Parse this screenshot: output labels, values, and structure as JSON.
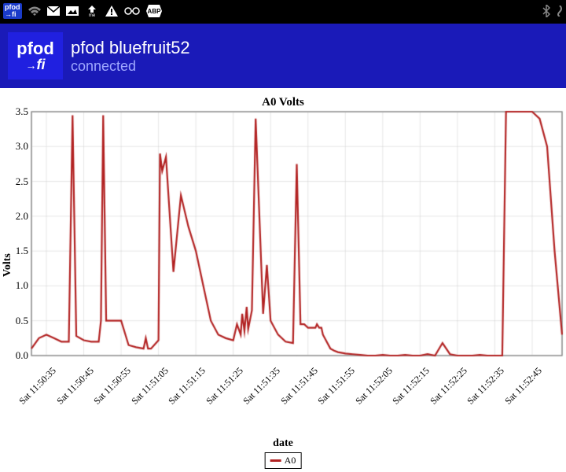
{
  "status_bar": {
    "left_icons": [
      "pfod-mini",
      "wifi-icon",
      "mail-icon",
      "picture-icon",
      "me-icon",
      "alert-icon",
      "glasses-icon",
      "abp-icon"
    ],
    "right_icons": [
      "bluetooth-icon",
      "battery-icon"
    ]
  },
  "header": {
    "logo_l1": "pfod",
    "logo_l2": "fi",
    "title": "pfod bluefruit52",
    "status": "connected"
  },
  "chart_data": {
    "type": "line",
    "title": "A0 Volts",
    "ylabel": "Volts",
    "xlabel": "date",
    "ylim": [
      0.0,
      3.5
    ],
    "ytick": [
      0.0,
      0.5,
      1.0,
      1.5,
      2.0,
      2.5,
      3.0,
      3.5
    ],
    "categories": [
      "Sat 11:50:35",
      "Sat 11:50:45",
      "Sat 11:50:55",
      "Sat 11:51:05",
      "Sat 11:51:15",
      "Sat 11:51:25",
      "Sat 11:51:35",
      "Sat 11:51:45",
      "Sat 11:51:55",
      "Sat 11:52:05",
      "Sat 11:52:15",
      "Sat 11:52:25",
      "Sat 11:52:35",
      "Sat 11:52:45"
    ],
    "legend": [
      "A0"
    ],
    "series": [
      {
        "name": "A0",
        "color": "#b22222",
        "x": [
          0,
          1,
          2,
          3,
          4,
          5,
          5.5,
          6,
          7,
          8,
          9,
          9.3,
          9.6,
          10,
          11,
          12,
          13,
          14,
          15,
          15.3,
          15.6,
          16,
          17,
          17.2,
          17.5,
          18,
          19,
          20,
          21,
          22,
          23,
          24,
          25,
          26,
          27,
          27.5,
          28,
          28.2,
          28.5,
          28.8,
          29,
          29.5,
          30,
          31,
          31.5,
          32,
          33,
          34,
          35,
          35.5,
          36,
          36.5,
          37,
          38,
          38.2,
          38.5,
          38.8,
          39,
          40,
          40.5,
          41,
          42,
          43,
          44,
          45,
          46,
          47,
          48,
          49,
          50,
          51,
          52,
          53,
          54,
          55,
          56,
          57,
          58,
          59,
          60,
          61,
          62,
          63,
          63.5,
          64,
          65,
          66,
          67,
          68,
          69,
          70,
          71
        ],
        "values": [
          0.1,
          0.25,
          0.3,
          0.25,
          0.2,
          0.2,
          3.45,
          0.28,
          0.22,
          0.2,
          0.2,
          0.5,
          3.45,
          0.5,
          0.5,
          0.5,
          0.15,
          0.12,
          0.1,
          0.25,
          0.1,
          0.1,
          0.22,
          2.9,
          2.65,
          2.85,
          1.2,
          2.3,
          1.85,
          1.5,
          1.0,
          0.5,
          0.3,
          0.25,
          0.22,
          0.45,
          0.3,
          0.6,
          0.35,
          0.7,
          0.38,
          0.65,
          3.4,
          0.6,
          1.3,
          0.5,
          0.3,
          0.2,
          0.18,
          2.75,
          0.45,
          0.45,
          0.4,
          0.4,
          0.45,
          0.4,
          0.4,
          0.3,
          0.1,
          0.07,
          0.05,
          0.03,
          0.02,
          0.01,
          0.0,
          0.0,
          0.01,
          0.0,
          0.0,
          0.01,
          0.0,
          0.0,
          0.02,
          0.0,
          0.18,
          0.02,
          0.0,
          0.0,
          0.0,
          0.01,
          0.0,
          0.0,
          0.0,
          3.5,
          3.5,
          3.5,
          3.5,
          3.5,
          3.4,
          3.0,
          1.5,
          0.3
        ]
      }
    ]
  }
}
